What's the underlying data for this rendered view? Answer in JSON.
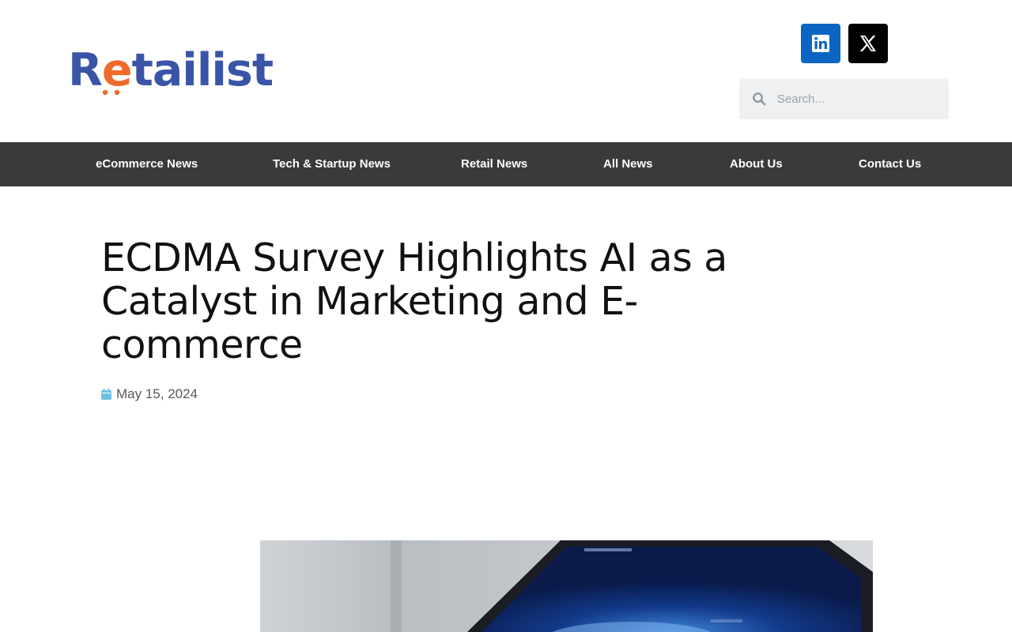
{
  "brand": {
    "logo_text": "Retailist"
  },
  "social": [
    {
      "name": "LinkedIn",
      "icon": "linkedin-icon"
    },
    {
      "name": "X",
      "icon": "x-icon"
    }
  ],
  "search": {
    "placeholder": "Search..."
  },
  "nav": {
    "items": [
      {
        "label": "eCommerce News"
      },
      {
        "label": "Tech & Startup News"
      },
      {
        "label": "Retail News"
      },
      {
        "label": "All News"
      },
      {
        "label": "About Us"
      },
      {
        "label": "Contact Us"
      }
    ]
  },
  "article": {
    "title": "ECDMA Survey Highlights AI as a Catalyst in Marketing and E-commerce",
    "date": "May 15, 2024",
    "date_icon": "calendar-icon"
  },
  "colors": {
    "brand_blue": "#3a55a8",
    "brand_orange": "#f06a2a",
    "nav_background": "#3a3a3a",
    "linkedin": "#0a66c2",
    "x": "#000000",
    "date_icon": "#6ec1e4"
  }
}
